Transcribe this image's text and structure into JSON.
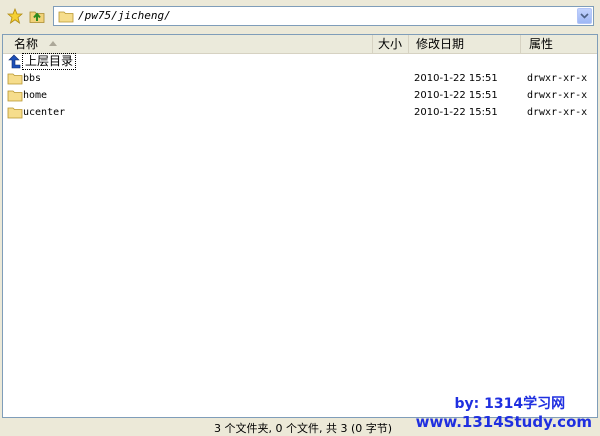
{
  "address": {
    "path": "/pw75/jicheng/"
  },
  "columns": {
    "name": "名称",
    "size": "大小",
    "date": "修改日期",
    "attr": "属性"
  },
  "parent_row": {
    "label": "上层目录"
  },
  "files": [
    {
      "name": "bbs",
      "date": "2010-1-22 15:51",
      "attr": "drwxr-xr-x"
    },
    {
      "name": "home",
      "date": "2010-1-22 15:51",
      "attr": "drwxr-xr-x"
    },
    {
      "name": "ucenter",
      "date": "2010-1-22 15:51",
      "attr": "drwxr-xr-x"
    }
  ],
  "status": {
    "summary": "3 个文件夹, 0 个文件, 共 3 (0 字节)"
  },
  "watermark": {
    "line1": "by: 1314学习网",
    "line2": "www.1314Study.com"
  }
}
